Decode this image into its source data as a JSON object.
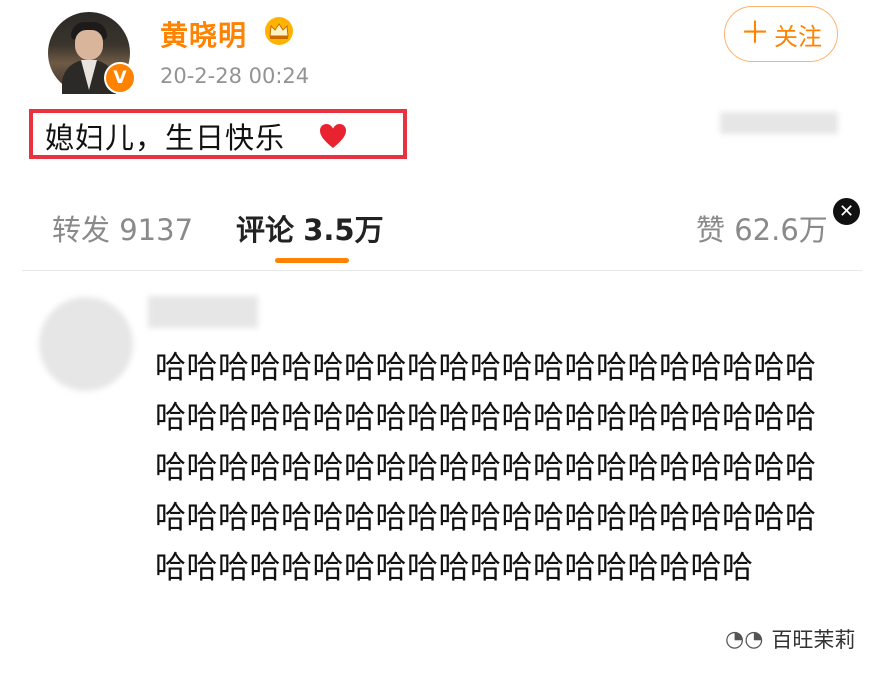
{
  "post": {
    "author": "黄晓明",
    "timestamp": "20-2-28 00:24",
    "follow_label": "关注",
    "text": "媳妇儿，生日快乐",
    "verify_badge": "V"
  },
  "stats": {
    "repost_label": "转发",
    "repost_count": "9137",
    "comment_label": "评论",
    "comment_count": "3.5万",
    "like_label": "赞",
    "like_count": "62.6万"
  },
  "comment": {
    "text": "哈哈哈哈哈哈哈哈哈哈哈哈哈哈哈哈哈哈哈哈哈哈哈哈哈哈哈哈哈哈哈哈哈哈哈哈哈哈哈哈哈哈哈哈哈哈哈哈哈哈哈哈哈哈哈哈哈哈哈哈哈哈哈哈哈哈哈哈哈哈哈哈哈哈哈哈哈哈哈哈哈哈哈哈哈哈哈哈哈哈哈哈哈哈哈哈哈哈哈哈哈哈哈"
  },
  "watermark": {
    "text": "百旺茉莉"
  },
  "colors": {
    "brand_orange": "#ff8200",
    "highlight_red": "#e63241",
    "heart_red": "#e8232f"
  },
  "icons": {
    "crown": "crown-icon",
    "heart": "heart-icon",
    "close": "close-icon",
    "plus": "plus-icon",
    "wechat": "wechat-icon"
  }
}
